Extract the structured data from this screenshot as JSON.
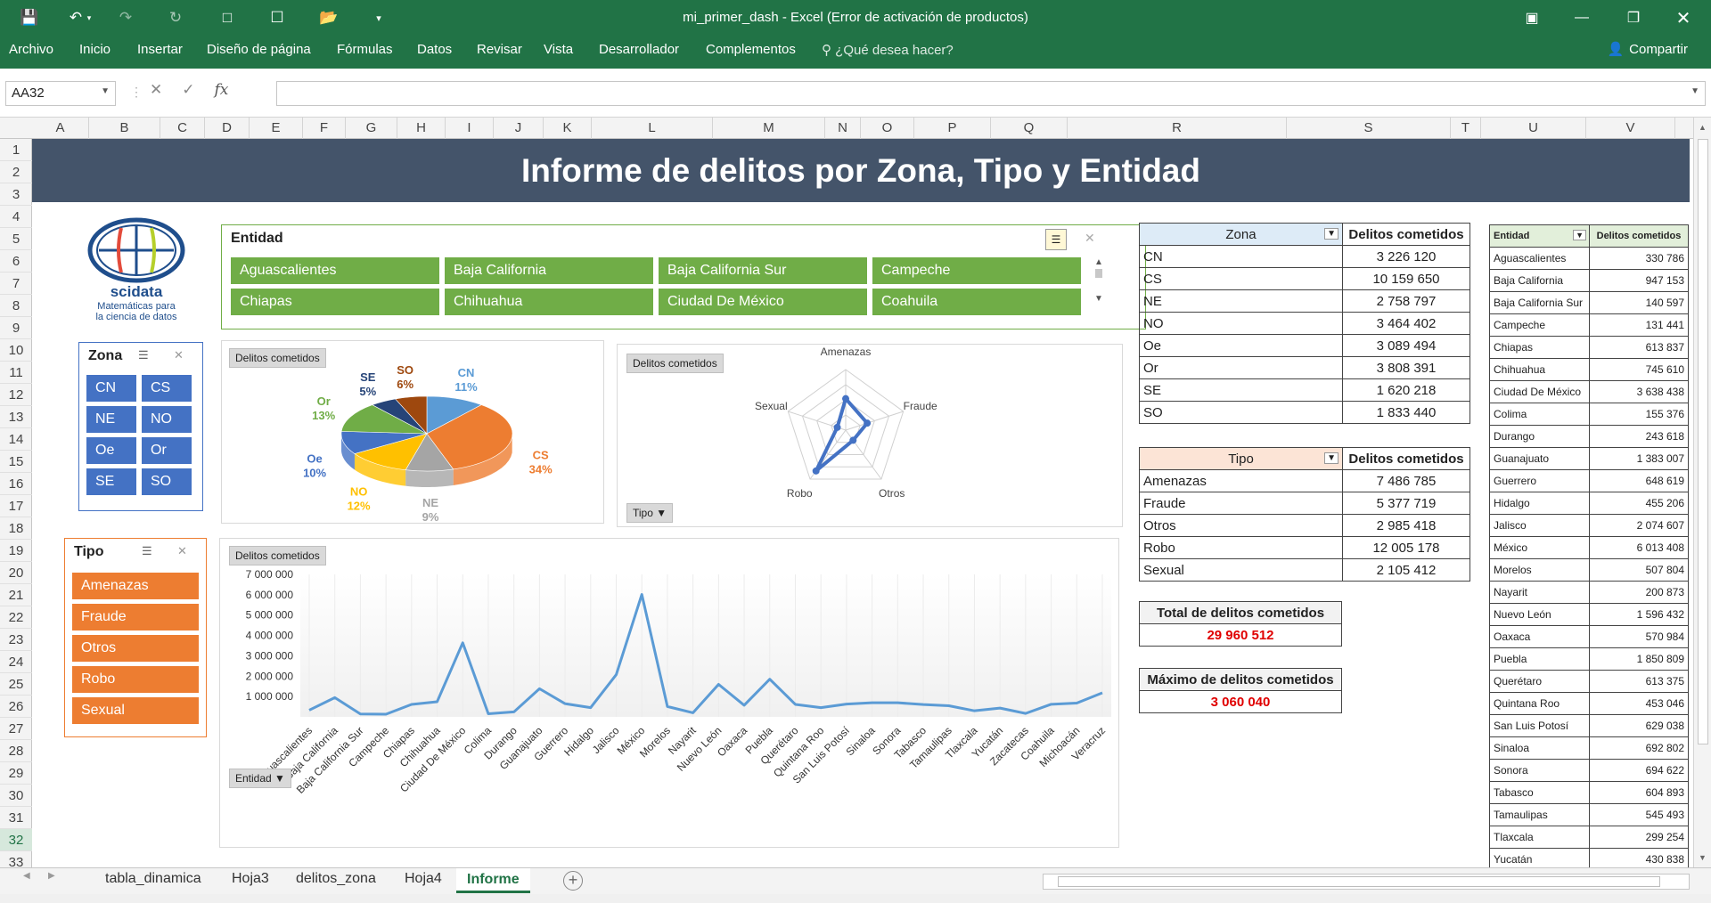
{
  "app": {
    "title": "mi_primer_dash - Excel (Error de activación de productos)",
    "share": "Compartir",
    "tellme": "¿Qué desea hacer?"
  },
  "ribbon_tabs": [
    "Archivo",
    "Inicio",
    "Insertar",
    "Diseño de página",
    "Fórmulas",
    "Datos",
    "Revisar",
    "Vista",
    "Desarrollador",
    "Complementos"
  ],
  "formula_bar": {
    "namebox": "AA32",
    "fx": "fx"
  },
  "columns": [
    "A",
    "B",
    "C",
    "D",
    "E",
    "F",
    "G",
    "H",
    "I",
    "J",
    "K",
    "L",
    "M",
    "N",
    "O",
    "P",
    "Q",
    "R",
    "S",
    "T",
    "U",
    "V"
  ],
  "rows": [
    "1",
    "2",
    "3",
    "4",
    "5",
    "6",
    "7",
    "8",
    "9",
    "10",
    "11",
    "12",
    "13",
    "14",
    "15",
    "16",
    "17",
    "18",
    "19",
    "20",
    "21",
    "22",
    "23",
    "24",
    "25",
    "26",
    "27",
    "28",
    "29",
    "30",
    "31",
    "32",
    "33"
  ],
  "banner": "Informe de delitos por Zona, Tipo y Entidad",
  "logo": {
    "name": "scidata",
    "tagline1": "Matemáticas para",
    "tagline2": "la ciencia de datos"
  },
  "slicer_entidad": {
    "title": "Entidad",
    "items": [
      "Aguascalientes",
      "Baja California",
      "Baja California Sur",
      "Campeche",
      "Chiapas",
      "Chihuahua",
      "Ciudad De México",
      "Coahuila"
    ]
  },
  "slicer_zona": {
    "title": "Zona",
    "items": [
      "CN",
      "CS",
      "NE",
      "NO",
      "Oe",
      "Or",
      "SE",
      "SO"
    ]
  },
  "slicer_tipo": {
    "title": "Tipo",
    "items": [
      "Amenazas",
      "Fraude",
      "Otros",
      "Robo",
      "Sexual"
    ]
  },
  "colors": {
    "green": "#70ad47",
    "blue": "#4472c4",
    "orange": "#ed7d31",
    "header": "#44546a",
    "excel": "#217346"
  },
  "field_buttons": {
    "delitos": "Delitos cometidos",
    "tipo": "Tipo",
    "entidad": "Entidad"
  },
  "chart_data": [
    {
      "type": "pie",
      "title": "",
      "categories": [
        "CN",
        "CS",
        "NE",
        "NO",
        "Oe",
        "Or",
        "SE",
        "SO"
      ],
      "values": [
        11,
        34,
        9,
        12,
        10,
        13,
        5,
        6
      ],
      "labels": [
        "11%",
        "34%",
        "9%",
        "12%",
        "10%",
        "13%",
        "5%",
        "6%"
      ]
    },
    {
      "type": "radar",
      "title": "",
      "categories": [
        "Amenazas",
        "Fraude",
        "Otros",
        "Robo",
        "Sexual"
      ],
      "values": [
        7486785,
        5377719,
        2985418,
        12005178,
        2105412
      ]
    },
    {
      "type": "line",
      "title": "",
      "y_ticks": [
        "7 000 000",
        "6 000 000",
        "5 000 000",
        "4 000 000",
        "3 000 000",
        "2 000 000",
        "1 000 000"
      ],
      "ylim": [
        0,
        7000000
      ],
      "categories": [
        "Aguascalientes",
        "Baja California",
        "Baja California Sur",
        "Campeche",
        "Chiapas",
        "Chihuahua",
        "Ciudad De México",
        "Colima",
        "Durango",
        "Guanajuato",
        "Guerrero",
        "Hidalgo",
        "Jalisco",
        "México",
        "Morelos",
        "Nayarit",
        "Nuevo León",
        "Oaxaca",
        "Puebla",
        "Querétaro",
        "Quintana Roo",
        "San Luis Potosí",
        "Sinaloa",
        "Sonora",
        "Tabasco",
        "Tamaulipas",
        "Tlaxcala",
        "Yucatán",
        "Zacatecas",
        "Coahuila",
        "Michoacán",
        "Veracruz"
      ],
      "values": [
        330786,
        947153,
        140597,
        131441,
        613837,
        745610,
        3638438,
        155376,
        243618,
        1383007,
        648619,
        455206,
        2074607,
        6013408,
        507804,
        200873,
        1596432,
        570984,
        1850809,
        613375,
        453046,
        629038,
        692802,
        694622,
        604893,
        545493,
        299254,
        430838,
        170000,
        620000,
        680000,
        1180000
      ]
    }
  ],
  "zona_table": {
    "h1": "Zona",
    "h2": "Delitos cometidos",
    "rows": [
      [
        "CN",
        "3 226 120"
      ],
      [
        "CS",
        "10 159 650"
      ],
      [
        "NE",
        "2 758 797"
      ],
      [
        "NO",
        "3 464 402"
      ],
      [
        "Oe",
        "3 089 494"
      ],
      [
        "Or",
        "3 808 391"
      ],
      [
        "SE",
        "1 620 218"
      ],
      [
        "SO",
        "1 833 440"
      ]
    ]
  },
  "tipo_table": {
    "h1": "Tipo",
    "h2": "Delitos cometidos",
    "rows": [
      [
        "Amenazas",
        "7 486 785"
      ],
      [
        "Fraude",
        "5 377 719"
      ],
      [
        "Otros",
        "2 985 418"
      ],
      [
        "Robo",
        "12 005 178"
      ],
      [
        "Sexual",
        "2 105 412"
      ]
    ]
  },
  "total": {
    "label": "Total de delitos cometidos",
    "value": "29 960 512"
  },
  "maximo": {
    "label": "Máximo de delitos cometidos",
    "value": "3 060 040"
  },
  "entidad_table": {
    "h1": "Entidad",
    "h2": "Delitos cometidos",
    "rows": [
      [
        "Aguascalientes",
        "330 786"
      ],
      [
        "Baja California",
        "947 153"
      ],
      [
        "Baja California Sur",
        "140 597"
      ],
      [
        "Campeche",
        "131 441"
      ],
      [
        "Chiapas",
        "613 837"
      ],
      [
        "Chihuahua",
        "745 610"
      ],
      [
        "Ciudad De México",
        "3 638 438"
      ],
      [
        "Colima",
        "155 376"
      ],
      [
        "Durango",
        "243 618"
      ],
      [
        "Guanajuato",
        "1 383 007"
      ],
      [
        "Guerrero",
        "648 619"
      ],
      [
        "Hidalgo",
        "455 206"
      ],
      [
        "Jalisco",
        "2 074 607"
      ],
      [
        "México",
        "6 013 408"
      ],
      [
        "Morelos",
        "507 804"
      ],
      [
        "Nayarit",
        "200 873"
      ],
      [
        "Nuevo León",
        "1 596 432"
      ],
      [
        "Oaxaca",
        "570 984"
      ],
      [
        "Puebla",
        "1 850 809"
      ],
      [
        "Querétaro",
        "613 375"
      ],
      [
        "Quintana Roo",
        "453 046"
      ],
      [
        "San Luis Potosí",
        "629 038"
      ],
      [
        "Sinaloa",
        "692 802"
      ],
      [
        "Sonora",
        "694 622"
      ],
      [
        "Tabasco",
        "604 893"
      ],
      [
        "Tamaulipas",
        "545 493"
      ],
      [
        "Tlaxcala",
        "299 254"
      ],
      [
        "Yucatán",
        "430 838"
      ]
    ]
  },
  "sheet_tabs": [
    "tabla_dinamica",
    "Hoja3",
    "delitos_zona",
    "Hoja4",
    "Informe"
  ]
}
